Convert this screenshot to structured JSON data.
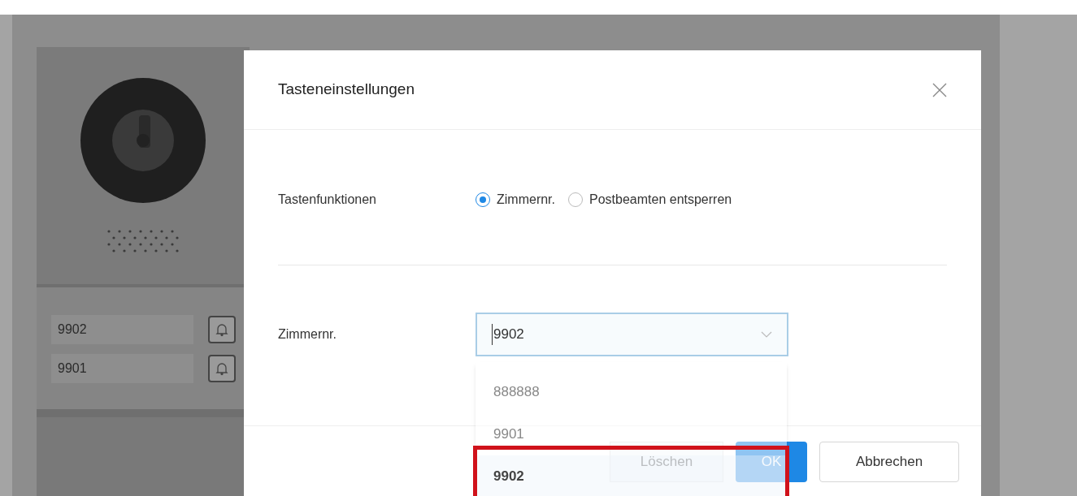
{
  "device": {
    "name_tags": [
      {
        "label": "9902"
      },
      {
        "label": "9901"
      }
    ]
  },
  "dialog": {
    "title": "Tasteneinstellungen",
    "fields": [
      {
        "kind": "radio",
        "label": "Tastenfunktionen",
        "options": [
          {
            "label": "Zimmernr.",
            "selected": true
          },
          {
            "label": "Postbeamten entsperren",
            "selected": false
          }
        ]
      },
      {
        "kind": "select",
        "label": "Zimmernr.",
        "value": "9902",
        "expanded": true,
        "options": [
          {
            "label": "888888",
            "selected": false
          },
          {
            "label": "9901",
            "selected": false
          },
          {
            "label": "9902",
            "selected": true
          }
        ]
      }
    ],
    "buttons": [
      {
        "label": "Löschen",
        "kind": "secondary"
      },
      {
        "label": "OK",
        "kind": "primary"
      },
      {
        "label": "Abbrechen",
        "kind": "default"
      }
    ]
  }
}
